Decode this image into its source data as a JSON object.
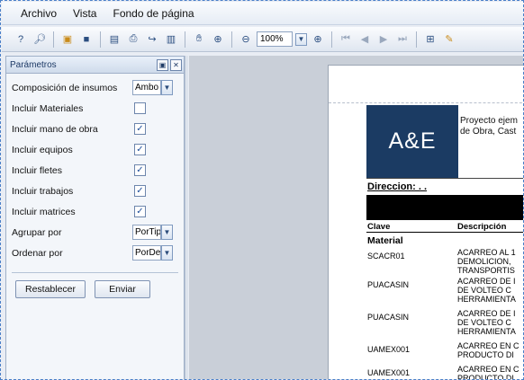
{
  "menu": {
    "items": [
      "Archivo",
      "Vista",
      "Fondo de página"
    ]
  },
  "toolbar": {
    "zoom_value": "100%",
    "icons": [
      "help-icon",
      "find-icon",
      "open-folder-icon",
      "save-icon",
      "page-setup-icon",
      "print-icon",
      "export-icon",
      "print-layout-icon",
      "hand-icon",
      "zoom-in-icon",
      "zoom-out-icon",
      "zoom-in-icon",
      "first-page-icon",
      "previous-page-icon",
      "next-page-icon",
      "last-page-icon",
      "tree-icon",
      "highlight-icon"
    ]
  },
  "panel": {
    "title": "Parámetros",
    "rows": [
      {
        "label": "Composición de insumos",
        "type": "select",
        "value": "Ambo"
      },
      {
        "label": "Incluir Materiales",
        "type": "checkbox",
        "checked": false
      },
      {
        "label": "Incluir mano de obra",
        "type": "checkbox",
        "checked": true
      },
      {
        "label": "Incluir equipos",
        "type": "checkbox",
        "checked": true
      },
      {
        "label": "Incluir fletes",
        "type": "checkbox",
        "checked": true
      },
      {
        "label": "Incluir trabajos",
        "type": "checkbox",
        "checked": true
      },
      {
        "label": "Incluir matrices",
        "type": "checkbox",
        "checked": true
      },
      {
        "label": "Agrupar por",
        "type": "select",
        "value": "PorTip"
      },
      {
        "label": "Ordenar por",
        "type": "select",
        "value": "PorDe"
      }
    ],
    "reset_label": "Restablecer",
    "send_label": "Enviar"
  },
  "report": {
    "logo_text": "A&E",
    "project_line1": "Proyecto ejem",
    "project_line2": "de Obra, Cast",
    "address_label": "Direccion: . .",
    "col_clave": "Clave",
    "col_desc": "Descripción",
    "section": "Material",
    "rows": [
      {
        "clave": "SCACR01",
        "desc": "ACARREO AL 1\nDEMOLICION,\nTRANSPORTIS"
      },
      {
        "clave": "PUACASIN",
        "desc": "ACARREO DE I\nDE VOLTEO C\nHERRAMIENTA"
      },
      {
        "clave": "PUACASIN",
        "desc": "ACARREO DE I\nDE VOLTEO C\nHERRAMIENTA"
      },
      {
        "clave": "UAMEX001",
        "desc": "ACARREO EN C\nPRODUCTO DI"
      },
      {
        "clave": "UAMEX001",
        "desc": "ACARREO EN C\nPRODUCTO DI"
      }
    ]
  },
  "colors": {
    "logo_bg": "#1b3b63",
    "accent": "#4a7fc8"
  }
}
